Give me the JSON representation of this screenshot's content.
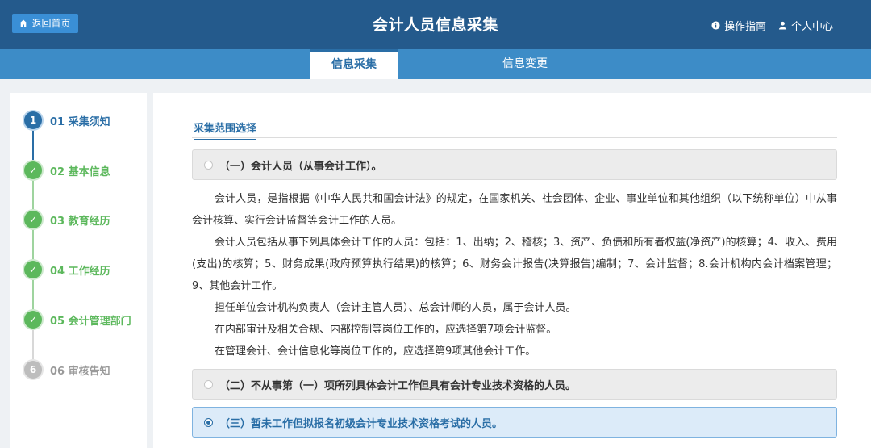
{
  "header": {
    "home_label": "返回首页",
    "title": "会计人员信息采集",
    "guide_label": "操作指南",
    "user_label": "个人中心"
  },
  "tabs": [
    {
      "label": "信息采集",
      "active": true
    },
    {
      "label": "信息变更",
      "active": false
    }
  ],
  "steps": [
    {
      "num": "1",
      "label": "01 采集须知",
      "state": "current"
    },
    {
      "num": "✓",
      "label": "02 基本信息",
      "state": "done"
    },
    {
      "num": "✓",
      "label": "03 教育经历",
      "state": "done"
    },
    {
      "num": "✓",
      "label": "04 工作经历",
      "state": "done"
    },
    {
      "num": "✓",
      "label": "05 会计管理部门",
      "state": "done"
    },
    {
      "num": "6",
      "label": "06 审核告知",
      "state": "todo"
    }
  ],
  "main": {
    "section_title": "采集范围选择",
    "options": [
      {
        "label": "（一）会计人员（从事会计工作）。",
        "selected": false
      },
      {
        "label": "（二）不从事第（一）项所列具体会计工作但具有会计专业技术资格的人员。",
        "selected": false
      },
      {
        "label": "（三）暂未工作但拟报名初级会计专业技术资格考试的人员。",
        "selected": true
      }
    ],
    "paragraphs": [
      "会计人员，是指根据《中华人民共和国会计法》的规定，在国家机关、社会团体、企业、事业单位和其他组织（以下统称单位）中从事会计核算、实行会计监督等会计工作的人员。",
      "会计人员包括从事下列具体会计工作的人员：包括：1、出纳；2、稽核；3、资产、负债和所有者权益(净资产)的核算；4、收入、费用(支出)的核算；5、财务成果(政府预算执行结果)的核算；6、财务会计报告(决算报告)编制；7、会计监督；8.会计机构内会计档案管理；9、其他会计工作。",
      "担任单位会计机构负责人（会计主管人员）、总会计师的人员，属于会计人员。",
      "在内部审计及相关合规、内部控制等岗位工作的，应选择第7项会计监督。",
      "在管理会计、会计信息化等岗位工作的，应选择第9项其他会计工作。"
    ]
  },
  "colors": {
    "header_bg": "#245a8c",
    "tabbar_bg": "#3d8cc7",
    "accent": "#2a6ea6",
    "done_green": "#5cb85c"
  }
}
